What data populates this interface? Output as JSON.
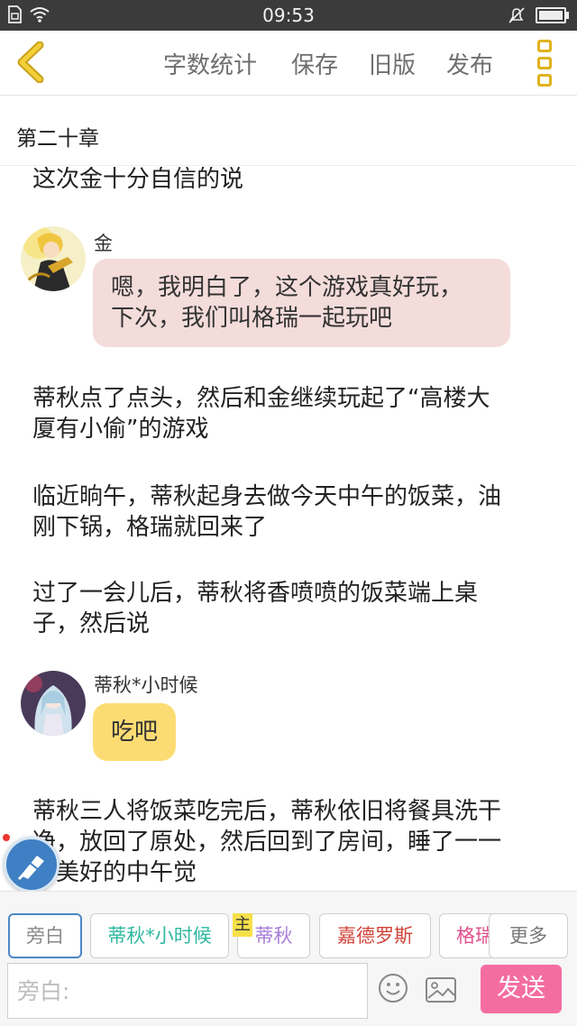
{
  "status_bar": {
    "time": "09:53"
  },
  "toolbar": {
    "word_count": "字数统计",
    "save": "保存",
    "old_version": "旧版",
    "publish": "发布"
  },
  "chapter": {
    "title": "第二十章"
  },
  "story": {
    "narration_1": "这次金十分自信的说",
    "speaker_1": "金",
    "bubble_1_line_1": "嗯，我明白了，这个游戏真好玩，",
    "bubble_1_line_2": "下次，我们叫格瑞一起玩吧",
    "narration_2_line_1": "蒂秋点了点头，然后和金继续玩起了“高楼大",
    "narration_2_line_2": "厦有小偷”的游戏",
    "narration_3_line_1": "临近晌午，蒂秋起身去做今天中午的饭菜，油",
    "narration_3_line_2": "刚下锅，格瑞就回来了",
    "narration_4_line_1": "过了一会儿后，蒂秋将香喷喷的饭菜端上桌",
    "narration_4_line_2": "子，然后说",
    "speaker_2": "蒂秋*小时候",
    "bubble_2": "吃吧",
    "narration_5_line_1": "蒂秋三人将饭菜吃完后，蒂秋依旧将餐具洗干",
    "narration_5_line_2": "净，放回了原处，然后回到了房间，睡了一一",
    "narration_5_line_3": "个美好的中午觉"
  },
  "roles": {
    "narrator": "旁白",
    "role_1": "蒂秋*小时候",
    "main_tag": "主",
    "role_2": "蒂秋",
    "role_3": "嘉德罗斯",
    "role_4": "格瑞",
    "more": "更多"
  },
  "input": {
    "placeholder": "旁白:",
    "send": "发送"
  },
  "colors": {
    "accent_yellow": "#e0b21c",
    "pink_bubble": "#f3dcda",
    "yellow_bubble": "#fcdc72",
    "send_button": "#f46da0",
    "role_1_text": "#2fb8a0",
    "role_2_text": "#a87ed8",
    "role_3_text": "#d0443a",
    "role_4_text": "#e0508c"
  }
}
